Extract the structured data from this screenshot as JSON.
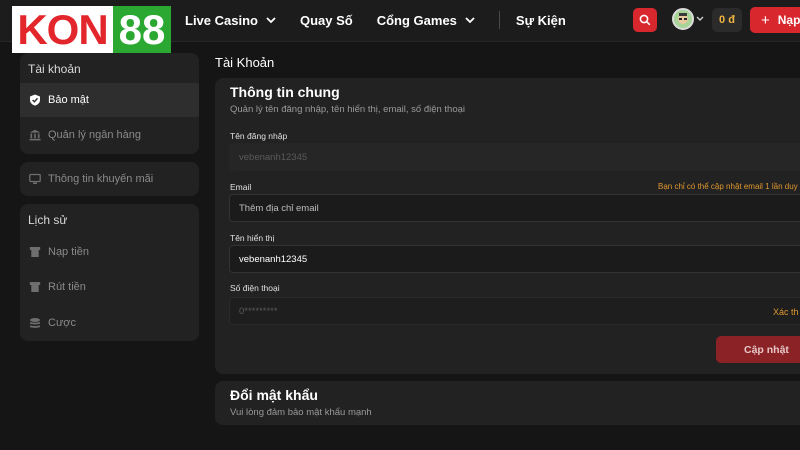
{
  "brand": {
    "logo_left": "KON",
    "logo_right": "88",
    "primary_color": "#d9272e",
    "logo_green": "#2aa832"
  },
  "nav": {
    "items": [
      {
        "label": "Live Casino",
        "has_dropdown": true
      },
      {
        "label": "Quay Số",
        "has_dropdown": false
      },
      {
        "label": "Cổng Games",
        "has_dropdown": true
      },
      {
        "label": "Sự Kiện",
        "has_dropdown": false
      }
    ]
  },
  "header": {
    "search_icon": "search-icon",
    "balance": "0 đ",
    "deposit_label": "Nạp",
    "deposit_icon": "plus-icon"
  },
  "sidebar": {
    "account_title": "Tài khoản",
    "account_items": [
      {
        "label": "Bảo mật",
        "icon": "shield-check-icon",
        "active": true
      },
      {
        "label": "Quản lý ngân hàng",
        "icon": "bank-icon",
        "active": false
      }
    ],
    "promo_item": {
      "label": "Thông tin khuyến mãi",
      "icon": "monitor-icon"
    },
    "history_title": "Lịch sử",
    "history_items": [
      {
        "label": "Nạp tiền",
        "icon": "deposit-icon"
      },
      {
        "label": "Rút tiền",
        "icon": "withdraw-icon"
      },
      {
        "label": "Cược",
        "icon": "coins-icon"
      }
    ]
  },
  "main": {
    "title": "Tài Khoản",
    "general": {
      "title": "Thông tin chung",
      "subtitle": "Quản lý tên đăng nhập, tên hiển thị, email, số điện thoại",
      "username_label": "Tên đăng nhập",
      "username_value": "vebenanh12345",
      "email_label": "Email",
      "email_note": "Bạn chỉ có thể cập nhật email 1 lần duy",
      "email_placeholder": "Thêm địa chỉ email",
      "display_name_label": "Tên hiển thị",
      "display_name_value": "vebenanh12345",
      "phone_label": "Số điện thoại",
      "phone_value": "0*********",
      "phone_action": "Xác th",
      "update_label": "Cập nhật"
    },
    "password": {
      "title": "Đổi mật khẩu",
      "subtitle": "Vui lòng đảm bảo mật khẩu mạnh"
    }
  }
}
